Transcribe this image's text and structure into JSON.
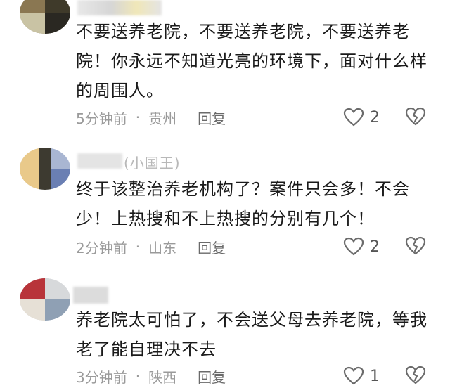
{
  "comments": [
    {
      "text": "不要送养老院，不要送养老院，不要送养老院！你永远不知道光亮的环境下，面对什么样的周围人。",
      "time": "5分钟前",
      "location": "贵州",
      "reply_label": "回复",
      "likes": "2"
    },
    {
      "name_fragment": "(小国王)",
      "text": "终于该整治养老机构了？案件只会多！不会少！上热搜和不上热搜的分别有几个！",
      "time": "2分钟前",
      "location": "山东",
      "reply_label": "回复",
      "likes": "2"
    },
    {
      "text": "养老院太可怕了，不会送父母去养老院，等我老了能自理决不去",
      "time": "3分钟前",
      "location": "陕西",
      "reply_label": "回复",
      "likes": "1"
    }
  ],
  "icons": {
    "like": "heart-outline-icon",
    "dislike": "broken-heart-icon"
  },
  "colors": {
    "text": "#1a1a1a",
    "meta": "#9a9a9a",
    "icon": "#6b6b6b"
  }
}
